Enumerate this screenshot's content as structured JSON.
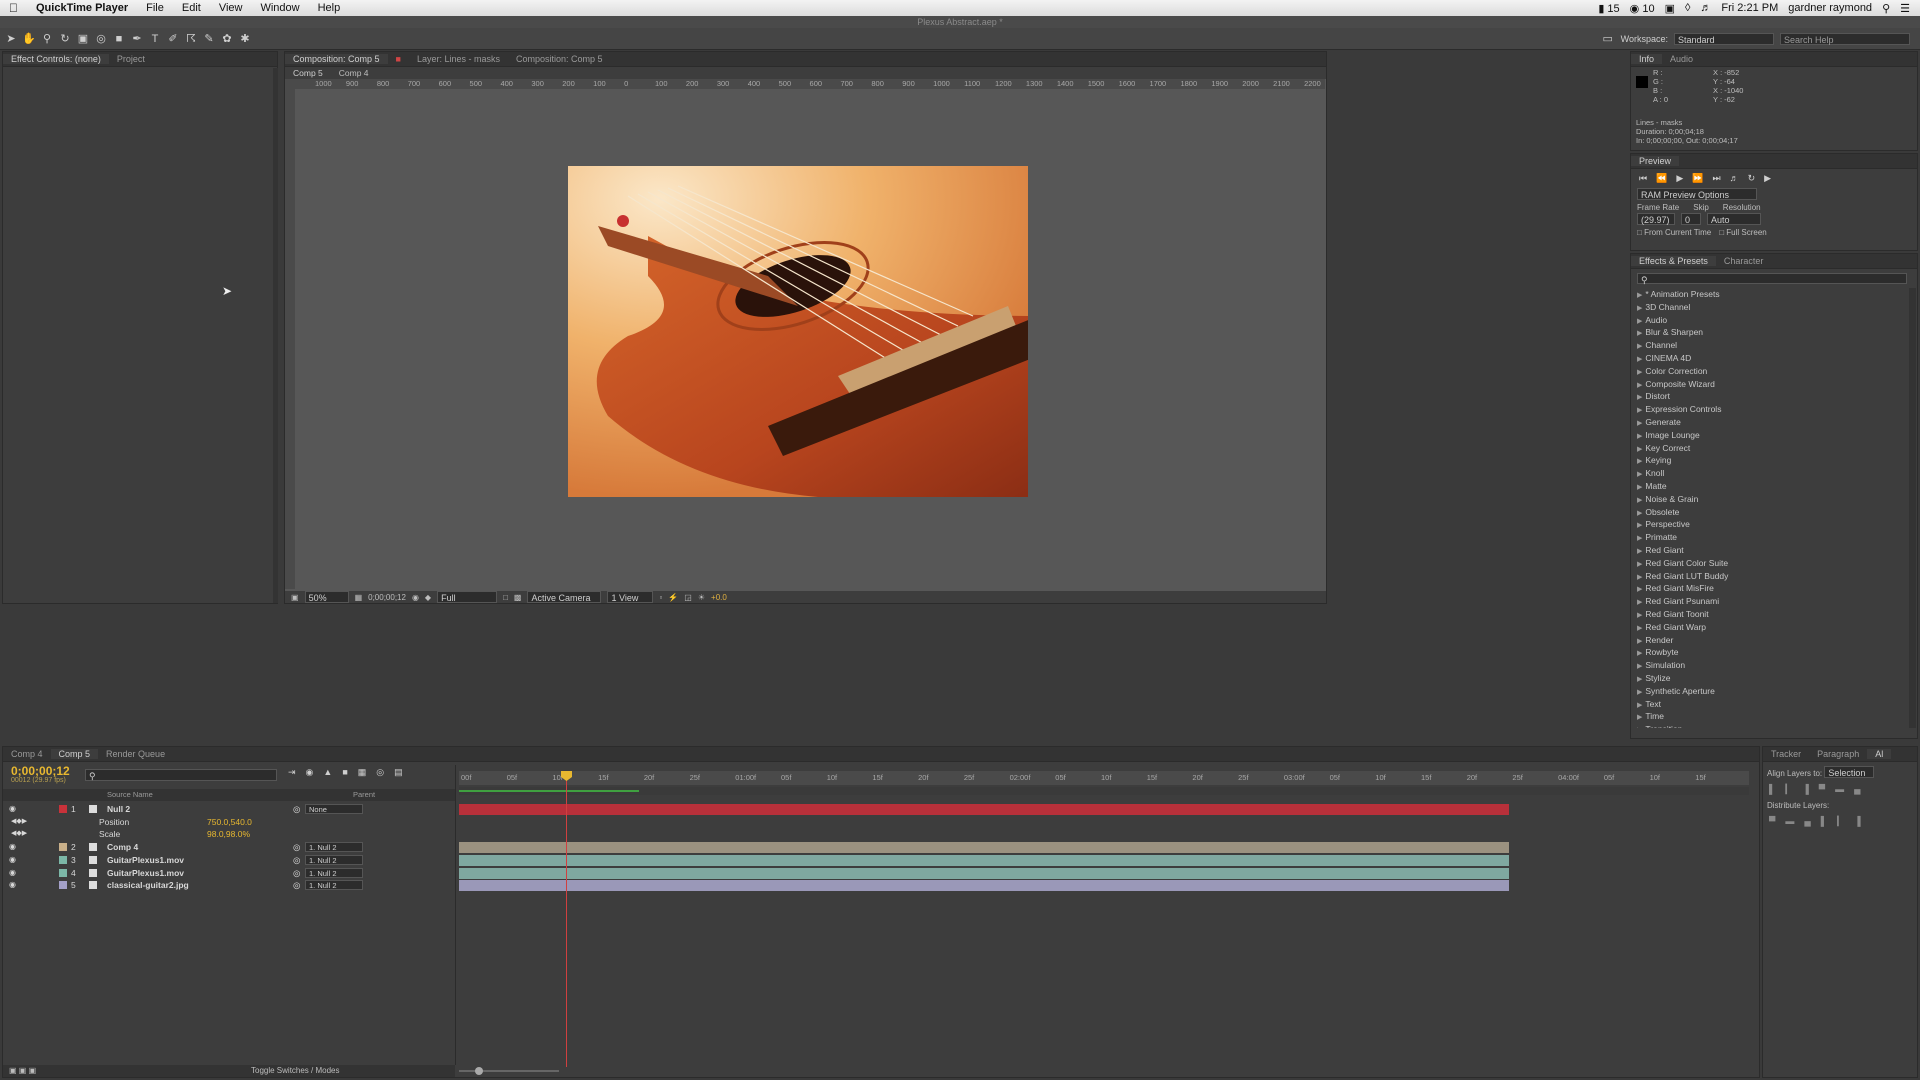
{
  "menubar": {
    "app_name": "QuickTime Player",
    "items": [
      "File",
      "Edit",
      "View",
      "Window",
      "Help"
    ],
    "status": {
      "battery_pct": "15",
      "notif": "10",
      "clock": "Fri 2:21 PM",
      "user": "gardner raymond"
    }
  },
  "window_title": "Plexus Abstract.aep *",
  "toolbar": {
    "workspace_label": "Workspace:",
    "workspace_value": "Standard",
    "search_placeholder": "Search Help"
  },
  "left_panel": {
    "tabs": [
      "Effect Controls: (none)",
      "Project"
    ]
  },
  "comp_panel": {
    "tabs": [
      "Composition: Comp 5",
      "Layer: Lines - masks",
      "Composition: Comp 5"
    ],
    "subtabs": [
      "Comp 5",
      "Comp 4"
    ],
    "ruler_labels": [
      "1000",
      "900",
      "800",
      "700",
      "600",
      "500",
      "400",
      "300",
      "200",
      "100",
      "0",
      "100",
      "200",
      "300",
      "400",
      "500",
      "600",
      "700",
      "800",
      "900",
      "1000",
      "1100",
      "1200",
      "1300",
      "1400",
      "1500",
      "1600",
      "1700",
      "1800",
      "1900",
      "2000",
      "2100",
      "2200"
    ],
    "footer": {
      "zoom": "50%",
      "timecode": "0;00;00;12",
      "resolution": "Full",
      "camera": "Active Camera",
      "view": "1 View",
      "exposure": "+0.0"
    }
  },
  "info_panel": {
    "tabs": [
      "Info",
      "Audio"
    ],
    "color_readout": [
      "R :",
      "G :",
      "B :",
      "A : 0"
    ],
    "coords": [
      "X : -852",
      "Y : -64",
      "X : -1040",
      "Y : -62"
    ],
    "layer_info": [
      "Lines - masks",
      "Duration: 0;00;04;18",
      "In: 0;00;00;00, Out: 0;00;04;17"
    ]
  },
  "preview_panel": {
    "tab": "Preview",
    "ram_options": "RAM Preview Options",
    "labels": [
      "Frame Rate",
      "Skip",
      "Resolution"
    ],
    "values": [
      "(29.97)",
      "0",
      "Auto"
    ],
    "checks": [
      "From Current Time",
      "Full Screen"
    ]
  },
  "effects_panel": {
    "tabs": [
      "Effects & Presets",
      "Character"
    ],
    "items": [
      "* Animation Presets",
      "3D Channel",
      "Audio",
      "Blur & Sharpen",
      "Channel",
      "CINEMA 4D",
      "Color Correction",
      "Composite Wizard",
      "Distort",
      "Expression Controls",
      "Generate",
      "Image Lounge",
      "Key Correct",
      "Keying",
      "Knoll",
      "Matte",
      "Noise & Grain",
      "Obsolete",
      "Perspective",
      "Primatte",
      "Red Giant",
      "Red Giant Color Suite",
      "Red Giant LUT Buddy",
      "Red Giant MisFire",
      "Red Giant Psunami",
      "Red Giant Toonit",
      "Red Giant Warp",
      "Render",
      "Rowbyte",
      "Simulation",
      "Stylize",
      "Synthetic Aperture",
      "Text",
      "Time",
      "Transition"
    ]
  },
  "timeline": {
    "tabs": [
      "Comp 4",
      "Comp 5",
      "Render Queue"
    ],
    "timecode": "0;00;00;12",
    "timecode_sub": "00012 (29.97 fps)",
    "col_source": "Source Name",
    "col_parent": "Parent",
    "ruler": [
      "00f",
      "05f",
      "10f",
      "15f",
      "20f",
      "25f",
      "01:00f",
      "05f",
      "10f",
      "15f",
      "20f",
      "25f",
      "02:00f",
      "05f",
      "10f",
      "15f",
      "20f",
      "25f",
      "03:00f",
      "05f",
      "10f",
      "15f",
      "20f",
      "25f",
      "04:00f",
      "05f",
      "10f",
      "15f"
    ],
    "layers": [
      {
        "num": "1",
        "name": "Null 2",
        "parent": "None",
        "color": "#c8323a",
        "bar": "#b8303a"
      },
      {
        "num": "",
        "name": "Position",
        "value": "750.0,540.0",
        "sub": true
      },
      {
        "num": "",
        "name": "Scale",
        "value": "98.0,98.0%",
        "sub": true
      },
      {
        "num": "2",
        "name": "Comp 4",
        "parent": "1. Null 2",
        "color": "#c9b08a",
        "bar": "#9b9280"
      },
      {
        "num": "3",
        "name": "GuitarPlexus1.mov",
        "parent": "1. Null 2",
        "color": "#7cb8a8",
        "bar": "#7fa8a0"
      },
      {
        "num": "4",
        "name": "GuitarPlexus1.mov",
        "parent": "1. Null 2",
        "color": "#7cb8a8",
        "bar": "#7fa8a0"
      },
      {
        "num": "5",
        "name": "classical-guitar2.jpg",
        "parent": "1. Null 2",
        "color": "#a3a0c8",
        "bar": "#9a98b8"
      }
    ],
    "footer": "Toggle Switches / Modes"
  },
  "align_panel": {
    "tabs": [
      "Tracker",
      "Paragraph",
      "Al"
    ],
    "align_label": "Align Layers to:",
    "align_value": "Selection",
    "distribute_label": "Distribute Layers:"
  }
}
